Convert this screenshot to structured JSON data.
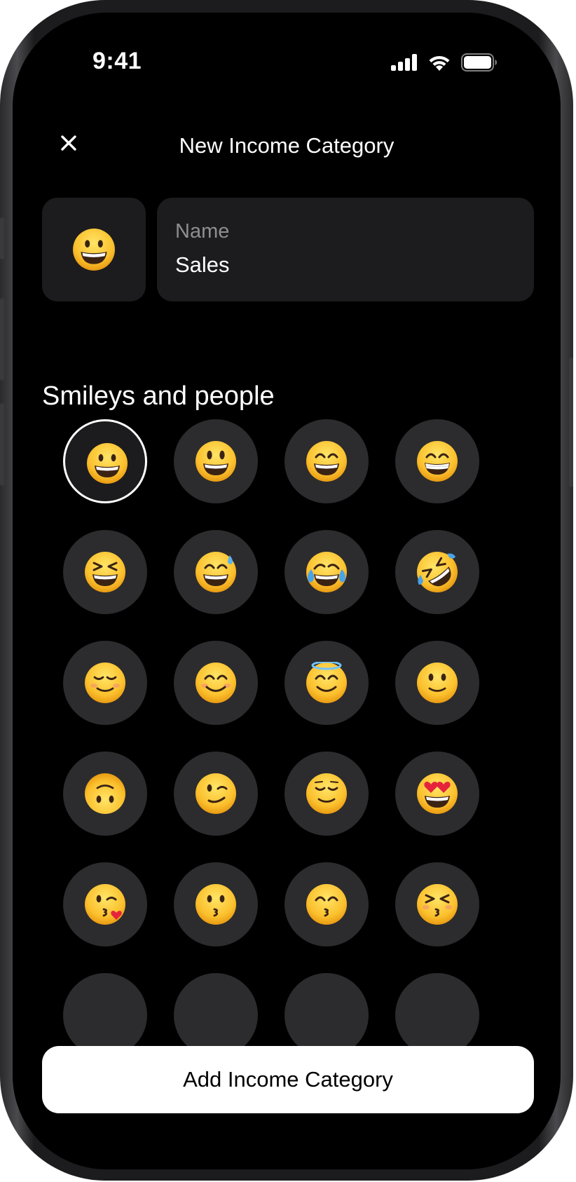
{
  "status_bar": {
    "time": "9:41",
    "icons": [
      "cellular-signal-icon",
      "wifi-icon",
      "battery-icon"
    ]
  },
  "header": {
    "title": "New Income Category",
    "close_icon": "close-icon"
  },
  "form": {
    "selected_icon": "grinning-face",
    "name_label": "Name",
    "name_value": "Sales"
  },
  "section": {
    "title": "Smileys and people"
  },
  "emojis": [
    {
      "name": "grinning-face",
      "selected": true
    },
    {
      "name": "grinning-face-big-eyes",
      "selected": false
    },
    {
      "name": "grinning-face-smiling-eyes",
      "selected": false
    },
    {
      "name": "beaming-face",
      "selected": false
    },
    {
      "name": "grinning-squinting-face",
      "selected": false
    },
    {
      "name": "grinning-face-sweat",
      "selected": false
    },
    {
      "name": "face-tears-of-joy",
      "selected": false
    },
    {
      "name": "rolling-on-floor-laughing",
      "selected": false
    },
    {
      "name": "smiling-face",
      "selected": false
    },
    {
      "name": "smiling-face-smiling-eyes",
      "selected": false
    },
    {
      "name": "smiling-face-halo",
      "selected": false
    },
    {
      "name": "slightly-smiling-face",
      "selected": false
    },
    {
      "name": "upside-down-face",
      "selected": false
    },
    {
      "name": "winking-face",
      "selected": false
    },
    {
      "name": "relieved-face",
      "selected": false
    },
    {
      "name": "smiling-face-heart-eyes",
      "selected": false
    },
    {
      "name": "face-blowing-kiss",
      "selected": false
    },
    {
      "name": "kissing-face",
      "selected": false
    },
    {
      "name": "kissing-face-smiling-eyes",
      "selected": false
    },
    {
      "name": "kissing-face-closed-eyes",
      "selected": false
    }
  ],
  "actions": {
    "add_label": "Add Income Category"
  },
  "colors": {
    "background": "#000000",
    "surface": "#1c1c1e",
    "cell": "#2c2c2e",
    "emoji_yellow": "#fbc02d",
    "primary_button": "#ffffff"
  }
}
